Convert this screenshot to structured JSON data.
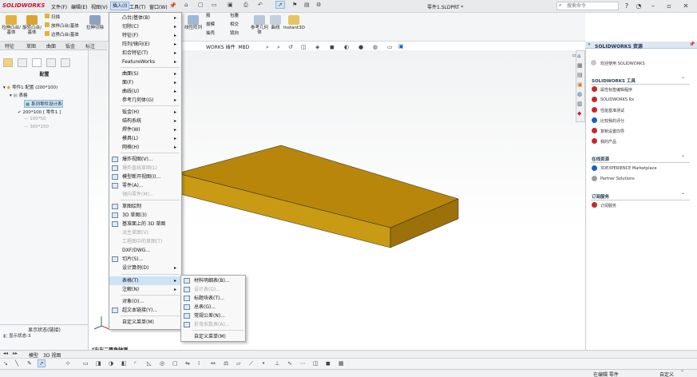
{
  "app": {
    "logo": "SOLIDWORKS",
    "document_title": "零件1.SLDPRT *",
    "search_placeholder": "搜索命令"
  },
  "menubar": {
    "items": [
      {
        "label": "文件(F)"
      },
      {
        "label": "编辑(E)"
      },
      {
        "label": "视图(V)"
      },
      {
        "label": "插入(I)"
      },
      {
        "label": "工具(T)"
      },
      {
        "label": "窗口(W)"
      }
    ]
  },
  "command_manager": {
    "tools": [
      {
        "label": "拉伸凸台/基体"
      },
      {
        "label": "旋转凸台/基体"
      },
      {
        "label": "扫描"
      },
      {
        "label": "放样凸台/基体"
      },
      {
        "label": "边界凸台/基体"
      },
      {
        "label": "拉伸切除"
      },
      {
        "label": "线性阵列"
      },
      {
        "label": "筋"
      },
      {
        "label": "拔模"
      },
      {
        "label": "抽壳"
      },
      {
        "label": "包覆"
      },
      {
        "label": "相交"
      },
      {
        "label": "镜向"
      },
      {
        "label": "参考几何体"
      },
      {
        "label": "曲线"
      },
      {
        "label": "Instant3D"
      }
    ],
    "tabs": [
      {
        "label": "特征"
      },
      {
        "label": "草图"
      },
      {
        "label": "曲面"
      },
      {
        "label": "钣金"
      },
      {
        "label": "标注"
      }
    ],
    "extra_tab": "MBD",
    "extra_tab_prefix": "WORKS 插件"
  },
  "left_panel": {
    "title": "配置",
    "tree": {
      "root": "零件1 配置 (200*100)",
      "table": "表格",
      "design_table": "系列零件设计表",
      "config_active": "200*100 [ 零件1 ]",
      "config_2": "100*50",
      "config_3": "300*150"
    },
    "display_states_title": "显示状态(链接)",
    "display_state": "显示状态-3"
  },
  "insert_menu": {
    "items": [
      {
        "label": "凸台/基体(B)",
        "arrow": "▸",
        "enabled": true
      },
      {
        "label": "切除(C)",
        "arrow": "▸",
        "enabled": true
      },
      {
        "label": "特征(F)",
        "arrow": "▸",
        "enabled": true
      },
      {
        "label": "阵列/镜向(E)",
        "arrow": "▸",
        "enabled": true
      },
      {
        "label": "扣合特征(T)",
        "arrow": "▸",
        "enabled": true
      },
      {
        "label": "FeatureWorks",
        "arrow": "▸",
        "enabled": true
      },
      {
        "label": "曲面(S)",
        "arrow": "▸",
        "enabled": true
      },
      {
        "label": "面(F)",
        "arrow": "▸",
        "enabled": true
      },
      {
        "label": "曲线(U)",
        "arrow": "▸",
        "enabled": true
      },
      {
        "label": "参考几何体(G)",
        "arrow": "▸",
        "enabled": true
      },
      {
        "label": "钣金(H)",
        "arrow": "▸",
        "enabled": true
      },
      {
        "label": "结构系统",
        "arrow": "▸",
        "enabled": true
      },
      {
        "label": "焊件(W)",
        "arrow": "▸",
        "enabled": true
      },
      {
        "label": "模具(L)",
        "arrow": "▸",
        "enabled": true
      },
      {
        "label": "网格(H)",
        "arrow": "▸",
        "enabled": true
      },
      {
        "label": "爆炸视图(V)...",
        "arrow": "",
        "enabled": true
      },
      {
        "label": "爆炸直线草图(L)",
        "arrow": "",
        "enabled": false
      },
      {
        "label": "模型断开视图(I)...",
        "arrow": "",
        "enabled": true
      },
      {
        "label": "零件(A)...",
        "arrow": "",
        "enabled": true
      },
      {
        "label": "镜向零件(M)...",
        "arrow": "",
        "enabled": false
      },
      {
        "label": "草图绘制",
        "arrow": "",
        "enabled": true
      },
      {
        "label": "3D 草图(3)",
        "arrow": "",
        "enabled": true
      },
      {
        "label": "基准面上的 3D 草图",
        "arrow": "",
        "enabled": true
      },
      {
        "label": "派生草图(V)",
        "arrow": "",
        "enabled": false
      },
      {
        "label": "工程图中的草图(T)",
        "arrow": "",
        "enabled": false
      },
      {
        "label": "DXF/DWG...",
        "arrow": "",
        "enabled": true
      },
      {
        "label": "切片(S)...",
        "arrow": "",
        "enabled": true
      },
      {
        "label": "设计算例(D)",
        "arrow": "▸",
        "enabled": true
      },
      {
        "label": "表格(T)",
        "arrow": "▸",
        "enabled": true
      },
      {
        "label": "注解(N)",
        "arrow": "▸",
        "enabled": true
      },
      {
        "label": "对象(O)...",
        "arrow": "",
        "enabled": true
      },
      {
        "label": "超文本链接(Y)...",
        "arrow": "",
        "enabled": true
      },
      {
        "label": "自定义菜单(M)",
        "arrow": "",
        "enabled": true
      }
    ]
  },
  "table_submenu": {
    "items": [
      {
        "label": "材料明细表(B)...",
        "enabled": true
      },
      {
        "label": "设计表(D)...",
        "enabled": false
      },
      {
        "label": "标题块表(T)...",
        "enabled": true
      },
      {
        "label": "总表(G)...",
        "enabled": true
      },
      {
        "label": "常规公差(N)...",
        "enabled": true
      },
      {
        "label": "折弯系数表(A)...",
        "enabled": false
      },
      {
        "label": "自定义菜单(M)",
        "enabled": true
      }
    ]
  },
  "task_pane": {
    "header": "SOLIDWORKS 资源",
    "welcome": "欢迎使用 SOLIDWORKS",
    "tools_title": "SOLIDWORKS 工具",
    "tools": [
      {
        "label": "属性标签编辑程序"
      },
      {
        "label": "SOLIDWORKS Rx"
      },
      {
        "label": "性能基准测试"
      },
      {
        "label": "比较我的评分"
      },
      {
        "label": "复制设置向导"
      },
      {
        "label": "我的产品"
      }
    ],
    "community_title": "在线资源",
    "community": [
      {
        "label": "3DEXPERIENCE Marketplace"
      },
      {
        "label": "Partner Solutions"
      }
    ],
    "subscription_title": "订阅服务",
    "subscription": [
      {
        "label": "订阅服务"
      }
    ]
  },
  "viewport": {
    "view_label": "*左右二等角轴测",
    "part_color_top": "#b8860b",
    "part_color_side": "#c99a14",
    "part_color_front": "#9c700a"
  },
  "bottom_tabs": {
    "items": [
      {
        "label": "模型"
      },
      {
        "label": "3D 视图"
      }
    ]
  },
  "status": {
    "edit_state": "在编辑 零件",
    "units": "自定义"
  }
}
